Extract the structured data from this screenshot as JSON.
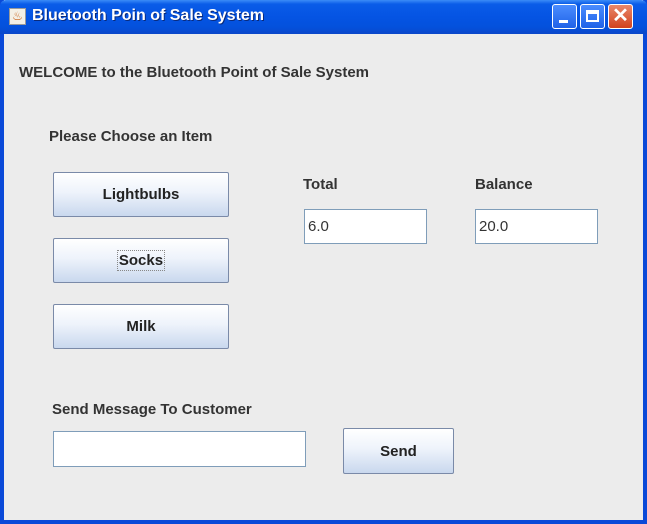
{
  "window": {
    "title": "Bluetooth Poin of Sale System",
    "icon": "java-cup-icon",
    "controls": {
      "minimize": "minimize-icon",
      "maximize": "maximize-icon",
      "close": "close-icon"
    }
  },
  "welcome_text": "WELCOME to the Bluetooth Point of Sale System",
  "items_section": {
    "label": "Please Choose an Item",
    "buttons": [
      "Lightbulbs",
      "Socks",
      "Milk"
    ]
  },
  "total": {
    "label": "Total",
    "value": "6.0"
  },
  "balance": {
    "label": "Balance",
    "value": "20.0"
  },
  "message": {
    "label": "Send Message To Customer",
    "value": "",
    "send_label": "Send"
  },
  "colors": {
    "titlebar": "#0554e3",
    "border": "#0a49d8",
    "background": "#ececec",
    "button_bottom": "#c9d8ee"
  }
}
